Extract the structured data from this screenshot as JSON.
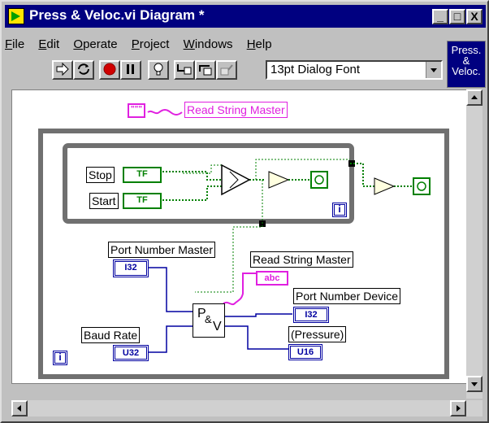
{
  "window": {
    "title": "Press & Veloc.vi Diagram *",
    "controls": {
      "minimize": "_",
      "maximize": "□",
      "close": "X"
    }
  },
  "menu": [
    {
      "label": "File",
      "key": "F",
      "rest": "ile"
    },
    {
      "label": "Edit",
      "key": "E",
      "rest": "dit"
    },
    {
      "label": "Operate",
      "key": "O",
      "rest": "perate"
    },
    {
      "label": "Project",
      "key": "P",
      "rest": "roject"
    },
    {
      "label": "Windows",
      "key": "W",
      "rest": "indows"
    },
    {
      "label": "Help",
      "key": "H",
      "rest": "elp"
    }
  ],
  "toolbar": {
    "font_selector": "13pt Dialog Font",
    "vi_icon_text": "Press.\n&\nVeloc."
  },
  "diagram": {
    "string_constant_glyph": "\"\"\"",
    "labels": {
      "read_string_master_top": "Read String Master",
      "stop": "Stop",
      "start": "Start",
      "port_number_master": "Port Number Master",
      "read_string_master": "Read String Master",
      "port_number_device": "Port Number Device",
      "baud_rate": "Baud Rate",
      "pressure": "(Pressure)"
    },
    "terminals": {
      "stop": "TF",
      "start": "TF",
      "port_number_master": "I32",
      "read_string_master": "abc",
      "port_number_device": "I32",
      "baud_rate": "U32",
      "pressure": "U16"
    },
    "subvi": {
      "p": "P",
      "amp": "&",
      "v": "V"
    },
    "iteration_outer": "i",
    "iteration_inner": "i"
  },
  "colors": {
    "titlebar": "#000080",
    "wire_blue": "#0000a0",
    "wire_green": "#008000",
    "wire_pink": "#e020e0",
    "loop_gray": "#707070"
  }
}
